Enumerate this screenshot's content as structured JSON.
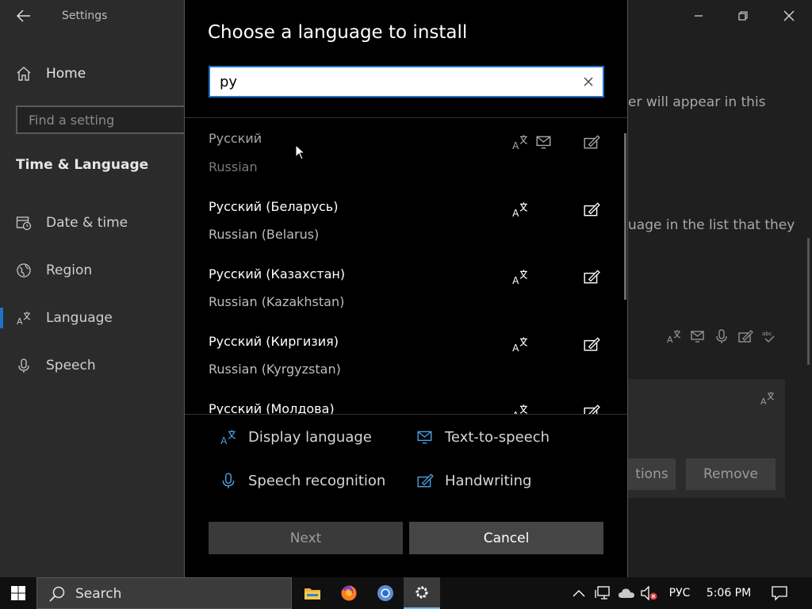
{
  "settings": {
    "title": "Settings",
    "home": "Home",
    "search_placeholder": "Find a setting",
    "section": "Time & Language",
    "nav": [
      "Date & time",
      "Region",
      "Language",
      "Speech"
    ],
    "bg_text_1": "er will appear in this",
    "bg_text_2": "uage in the list that they",
    "options_btn": "tions",
    "remove_btn": "Remove"
  },
  "dialog": {
    "title": "Choose a language to install",
    "search_value": "ру",
    "languages": [
      {
        "native": "Русский",
        "english": "Russian"
      },
      {
        "native": "Русский (Беларусь)",
        "english": "Russian (Belarus)"
      },
      {
        "native": "Русский (Казахстан)",
        "english": "Russian (Kazakhstan)"
      },
      {
        "native": "Русский (Киргизия)",
        "english": "Russian (Kyrgyzstan)"
      },
      {
        "native": "Русский (Молдова)",
        "english": ""
      }
    ],
    "legend": {
      "display_language": "Display language",
      "text_to_speech": "Text-to-speech",
      "speech_recognition": "Speech recognition",
      "handwriting": "Handwriting"
    },
    "next_label": "Next",
    "cancel_label": "Cancel"
  },
  "taskbar": {
    "search_label": "Search",
    "input_language": "РУС",
    "time": "5:06 PM"
  },
  "colors": {
    "accent": "#1e73c8",
    "icon_blue": "#4ca0e0"
  }
}
